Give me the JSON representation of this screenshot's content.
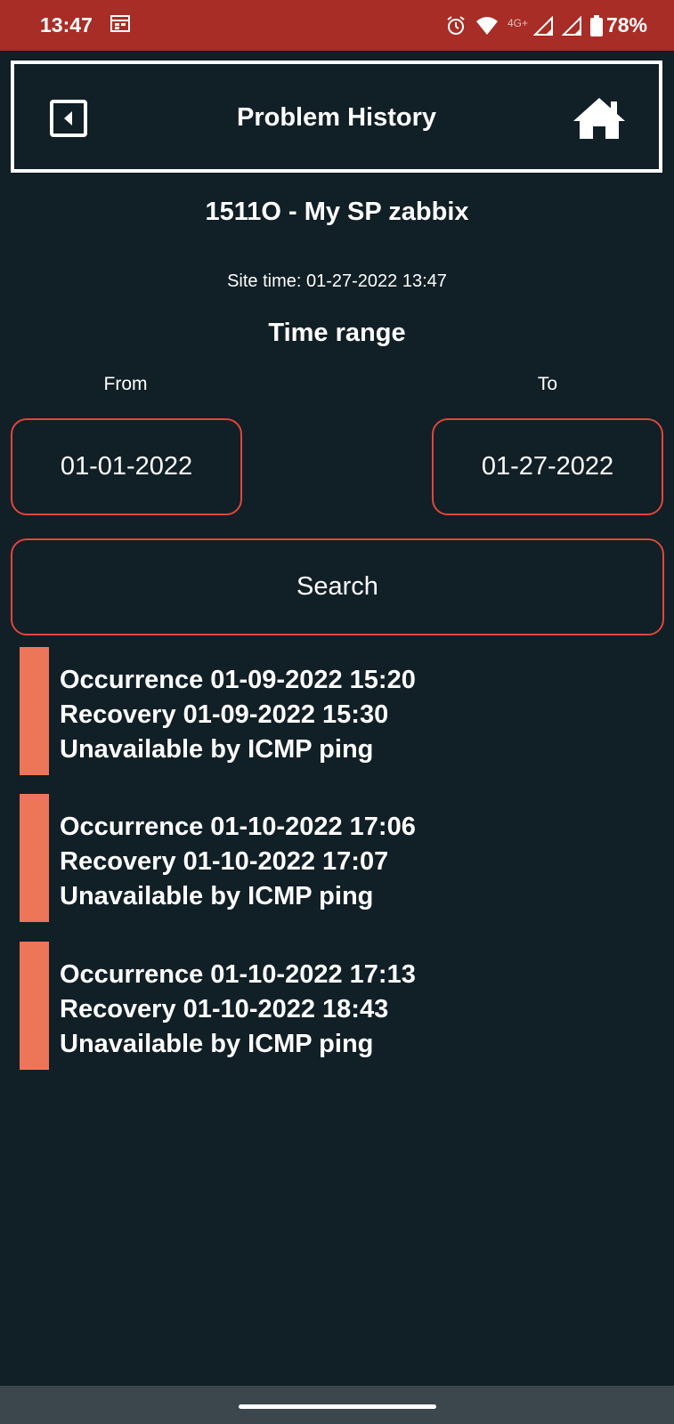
{
  "status_bar": {
    "time": "13:47",
    "network": "4G+",
    "battery": "78%",
    "icons": [
      "calendar-icon",
      "alarm-icon",
      "wifi-icon",
      "signal-icon",
      "signal-icon",
      "battery-icon"
    ]
  },
  "header": {
    "title": "Problem History",
    "back_icon": "back-icon",
    "home_icon": "home-icon"
  },
  "site": {
    "name": "1511O - My SP zabbix",
    "time": "Site time: 01-27-2022 13:47"
  },
  "range": {
    "title": "Time range",
    "from_label": "From",
    "to_label": "To",
    "from_value": "01-01-2022",
    "to_value": "01-27-2022"
  },
  "search": {
    "label": "Search"
  },
  "problems": [
    {
      "occurrence": "Occurrence 01-09-2022 15:20",
      "recovery": "Recovery 01-09-2022 15:30",
      "description": "Unavailable by ICMP ping"
    },
    {
      "occurrence": "Occurrence 01-10-2022 17:06",
      "recovery": "Recovery 01-10-2022 17:07",
      "description": "Unavailable by ICMP ping"
    },
    {
      "occurrence": "Occurrence 01-10-2022 17:13",
      "recovery": "Recovery 01-10-2022 18:43",
      "description": "Unavailable by ICMP ping"
    }
  ],
  "colors": {
    "background": "#111f26",
    "status_bar": "#a82d26",
    "accent_border": "#e0463a",
    "problem_bar": "#ed7658"
  }
}
